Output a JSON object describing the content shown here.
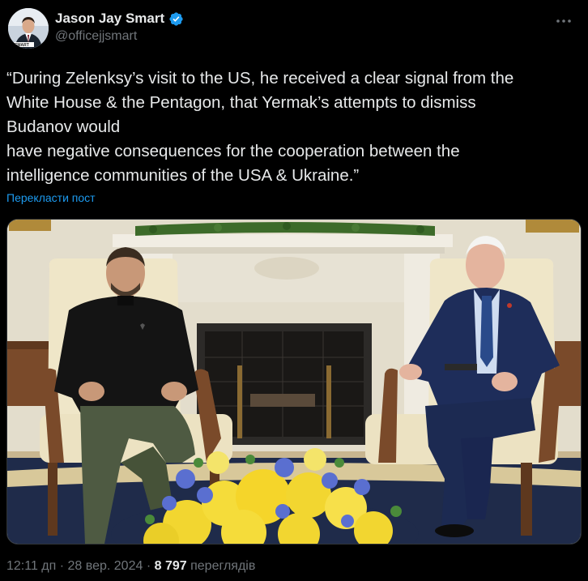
{
  "author": {
    "display_name": "Jason Jay Smart",
    "handle": "@officejjsmart",
    "avatar_caption": "SMART",
    "verified_color": "#1d9bf0"
  },
  "tweet": {
    "text": "“During Zelenksy’s visit to the US, he received a clear signal from the\nWhite House & the Pentagon, that Yermak’s attempts to dismiss\nBudanov would\nhave negative consequences for the cooperation between the\nintelligence communities of the USA & Ukraine.”",
    "translate_label": "Перекласти пост"
  },
  "meta": {
    "time": "12:11 дп",
    "separator": "·",
    "date": "28 вер. 2024",
    "views_count": "8 797",
    "views_label": "переглядів"
  },
  "icons": {
    "more": "more-dots-icon",
    "verified": "verified-badge-icon"
  },
  "colors": {
    "background": "#000000",
    "text": "#e7e9ea",
    "secondary": "#71767b",
    "link": "#1d9bf0"
  }
}
